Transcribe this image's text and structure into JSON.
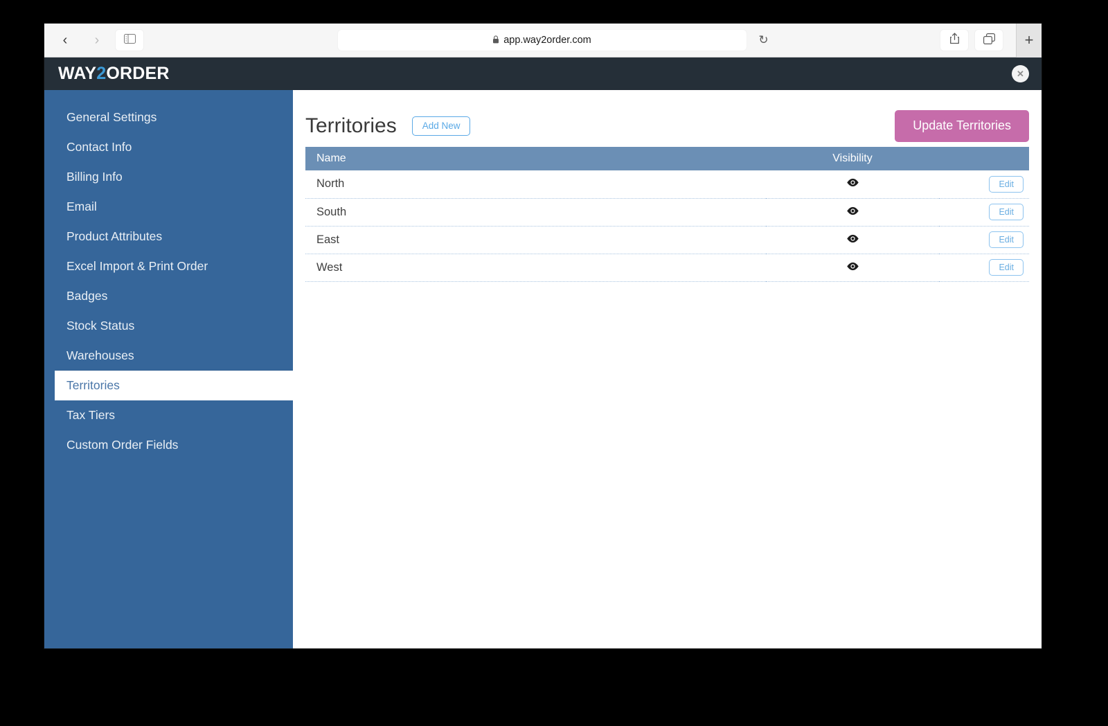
{
  "browser": {
    "back_icon": "back-chevron-icon",
    "forward_icon": "forward-chevron-icon",
    "sidebar_icon": "sidebar-toggle-icon",
    "lock_glyph": "\u0001",
    "url": "app.way2order.com",
    "reload_glyph": "↻",
    "share_icon": "share-icon",
    "tabs_icon": "tab-overview-icon",
    "newtab_label": "+"
  },
  "header": {
    "logo_pre": "WAY",
    "logo_hl": "2",
    "logo_post": "ORDER",
    "close_label": "✕"
  },
  "sidebar": {
    "items": [
      {
        "label": "General Settings",
        "active": false
      },
      {
        "label": "Contact Info",
        "active": false
      },
      {
        "label": "Billing Info",
        "active": false
      },
      {
        "label": "Email",
        "active": false
      },
      {
        "label": "Product Attributes",
        "active": false
      },
      {
        "label": "Excel Import & Print Order",
        "active": false
      },
      {
        "label": "Badges",
        "active": false
      },
      {
        "label": "Stock Status",
        "active": false
      },
      {
        "label": "Warehouses",
        "active": false
      },
      {
        "label": "Territories",
        "active": true
      },
      {
        "label": "Tax Tiers",
        "active": false
      },
      {
        "label": "Custom Order Fields",
        "active": false
      }
    ]
  },
  "main": {
    "title": "Territories",
    "add_new_label": "Add New",
    "update_label": "Update Territories",
    "table": {
      "columns": [
        "Name",
        "Visibility",
        ""
      ],
      "rows": [
        {
          "name": "North",
          "visibility": "visible",
          "action": "Edit"
        },
        {
          "name": "South",
          "visibility": "visible",
          "action": "Edit"
        },
        {
          "name": "East",
          "visibility": "visible",
          "action": "Edit"
        },
        {
          "name": "West",
          "visibility": "visible",
          "action": "Edit"
        }
      ]
    }
  },
  "colors": {
    "sidebar_blue": "#36669a",
    "header_dark": "#252f38",
    "table_header_blue": "#6b8fb5",
    "update_pink": "#c66caa",
    "link_blue": "#5aa9e6",
    "logo_accent": "#3c9ad6"
  }
}
